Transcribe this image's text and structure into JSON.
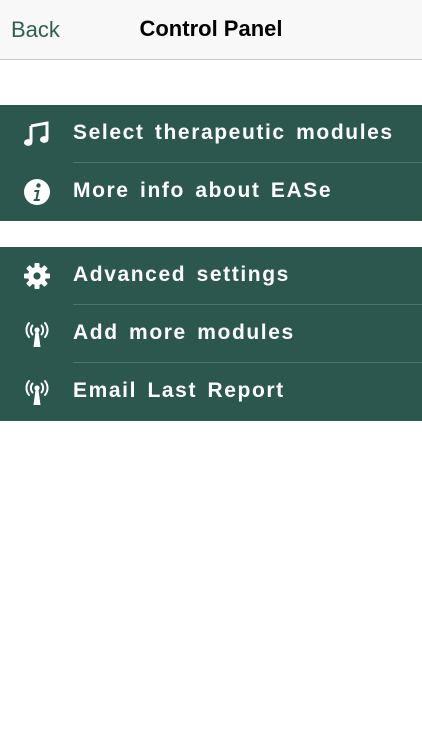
{
  "nav": {
    "back_label": "Back",
    "title": "Control Panel"
  },
  "groups": [
    {
      "items": [
        {
          "label": "Select therapeutic modules",
          "icon": "music-note-icon"
        },
        {
          "label": "More info about EASe",
          "icon": "info-icon"
        }
      ]
    },
    {
      "items": [
        {
          "label": "Advanced settings",
          "icon": "gear-icon"
        },
        {
          "label": "Add more modules",
          "icon": "antenna-icon"
        },
        {
          "label": "Email Last Report",
          "icon": "antenna-icon"
        }
      ]
    }
  ],
  "colors": {
    "accent": "#2e5f55",
    "row_background": "#2c574f",
    "separator": "#4e766e",
    "text_on_rows": "#ffffff"
  }
}
